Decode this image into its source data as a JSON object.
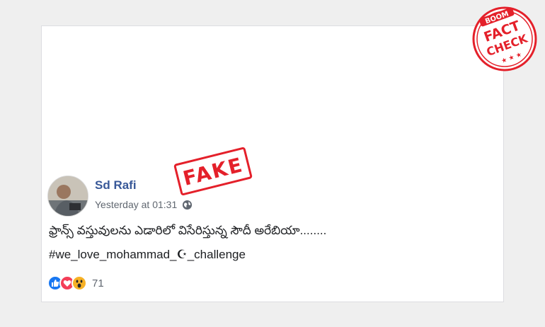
{
  "post": {
    "author": "Sd Rafi",
    "timestamp": "Yesterday at 01:31",
    "text": "ఫ్రాన్స్ వస్తువులను ఎడారిలో విసేరిస్తున్న సౌదీ అరేబియా........",
    "hashtag": "#we_love_mohammad_☪_challenge",
    "reaction_count": "71",
    "reactions": [
      "like-icon",
      "love-icon",
      "wow-icon"
    ]
  },
  "stamps": {
    "fake": "FAKE",
    "boom": "BOOM",
    "fact": "FACT",
    "check": "CHECK",
    "stars": "★ ★ ★"
  },
  "colors": {
    "author_blue": "#385898",
    "stamp_red": "#e4202a",
    "like_blue": "#1877f2",
    "love_red": "#f33e58",
    "wow_yellow": "#f7b125"
  }
}
